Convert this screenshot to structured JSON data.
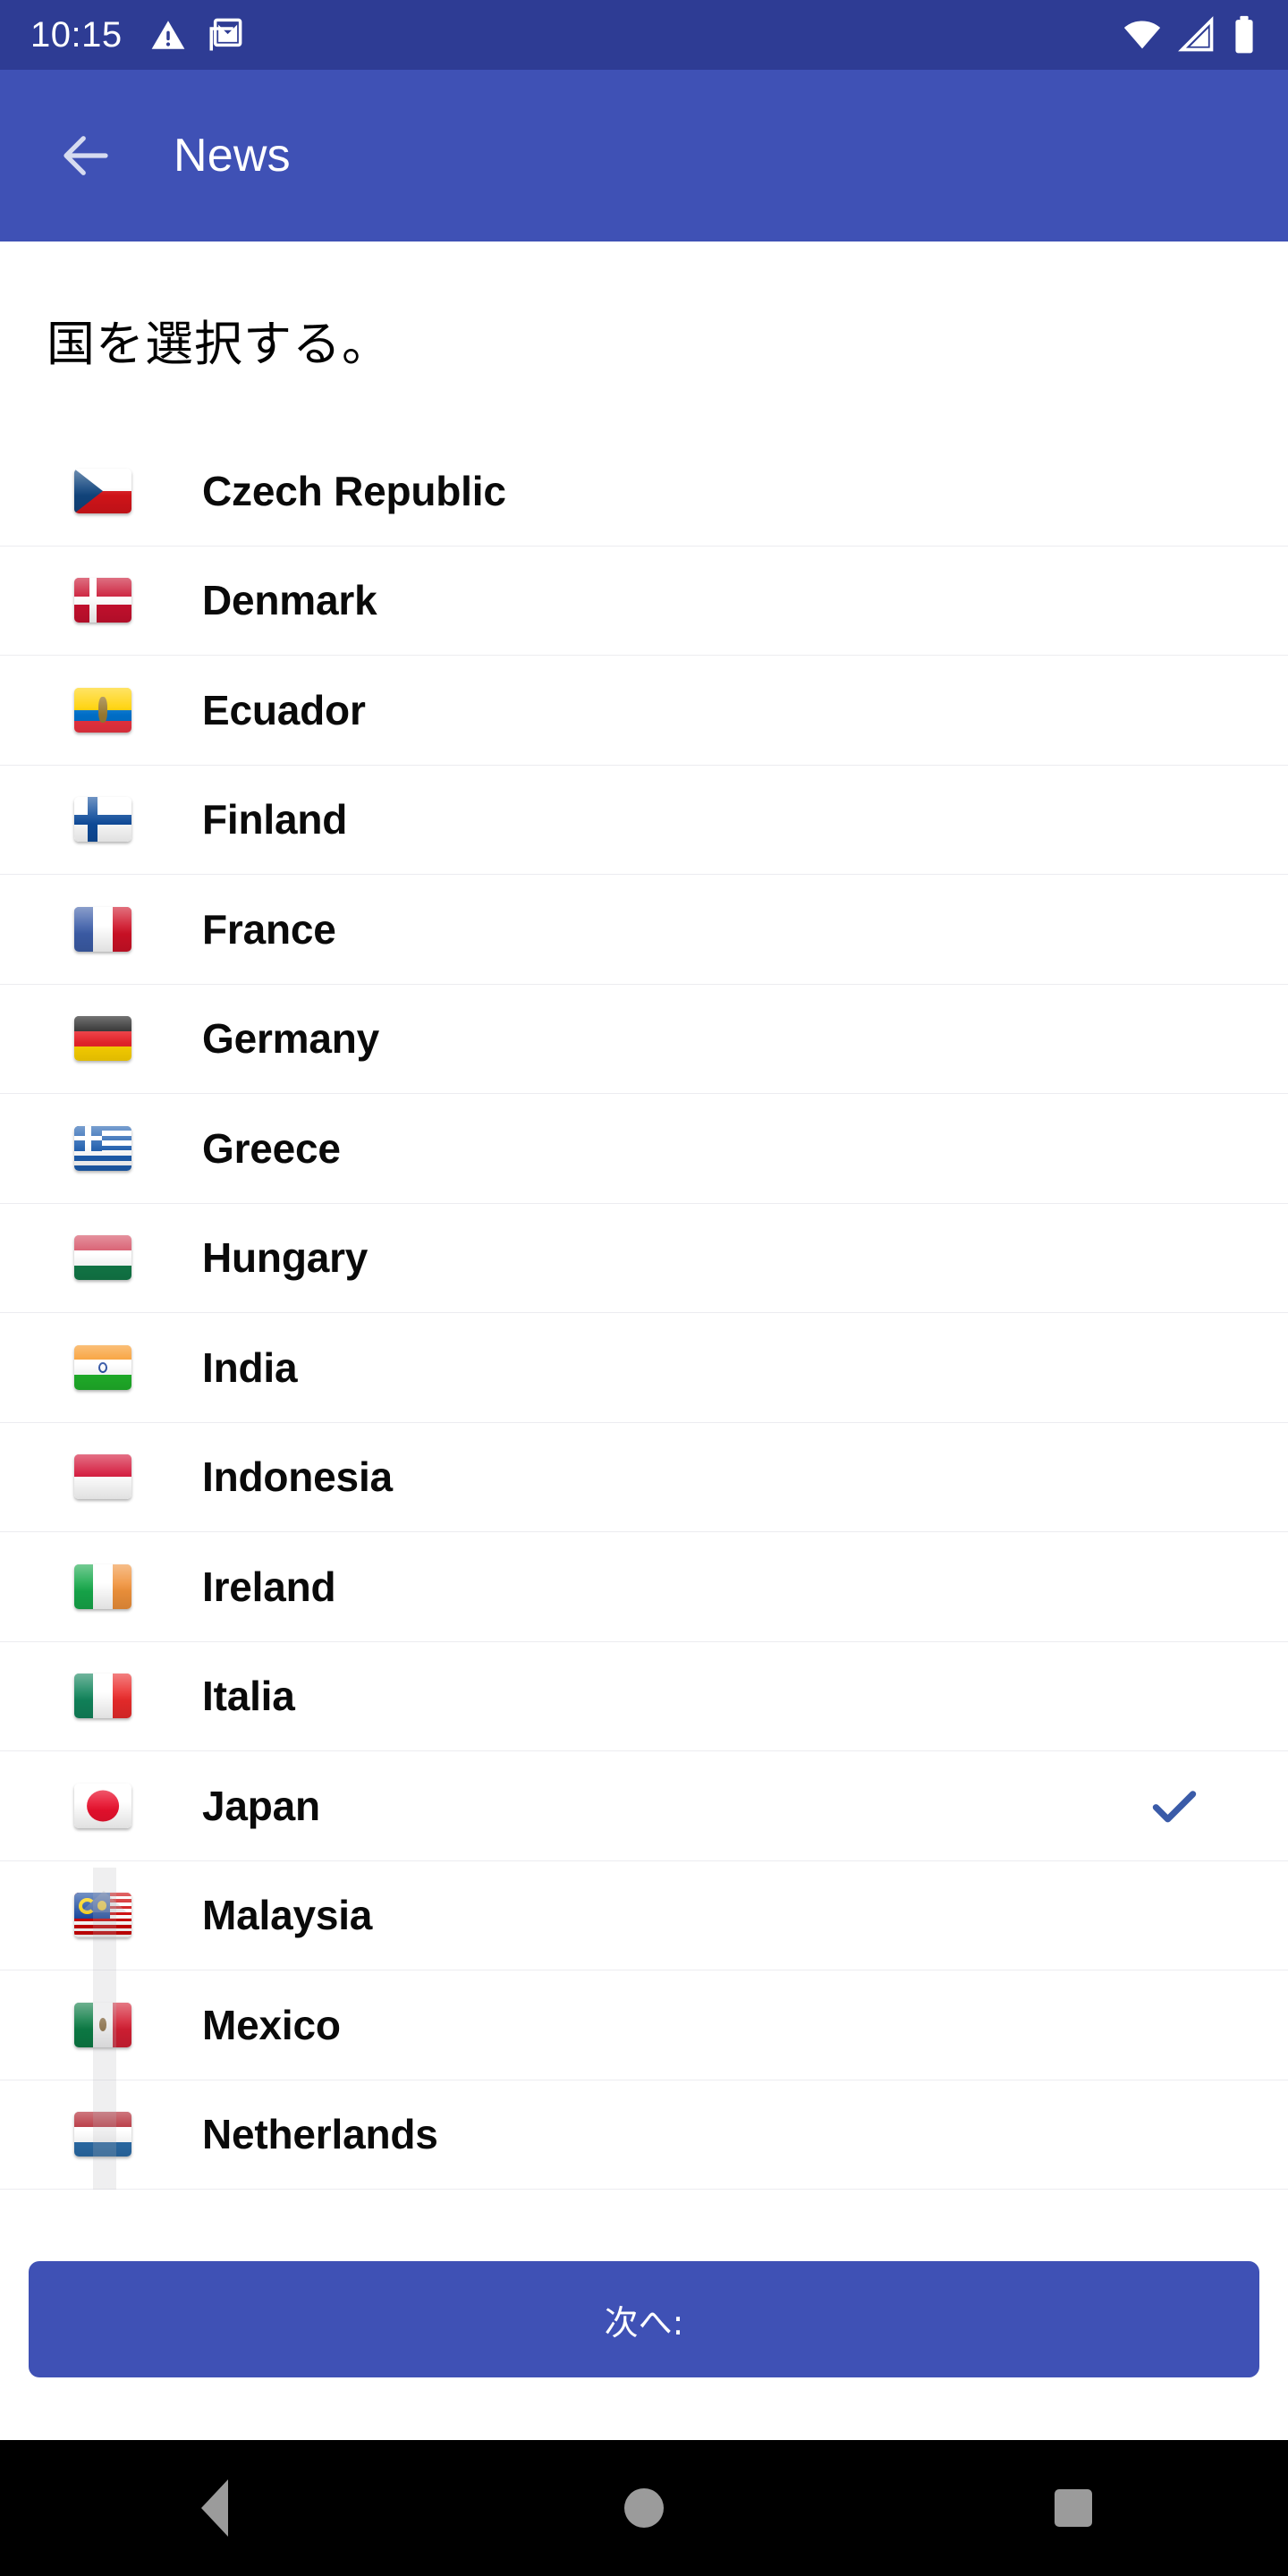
{
  "status_bar": {
    "time": "10:15",
    "left_icons": [
      "warning-triangle-icon",
      "gmail-icon"
    ],
    "right_icons": [
      "wifi-icon",
      "cell-signal-icon",
      "battery-icon"
    ],
    "background_color": "#2E3C94",
    "foreground_color": "#FFFFFF"
  },
  "app_bar": {
    "back_icon": "arrow-left-icon",
    "title": "News",
    "background_color": "#3F51B5",
    "text_color": "#FFFFFF"
  },
  "heading": {
    "text": "国を選択する。"
  },
  "list": {
    "selected_country": "Japan",
    "check_icon": "check-icon",
    "check_color": "#3A5BA8",
    "items": [
      {
        "name": "Czech Republic",
        "flag": "flag-cz",
        "selected": false
      },
      {
        "name": "Denmark",
        "flag": "flag-dk",
        "selected": false
      },
      {
        "name": "Ecuador",
        "flag": "flag-ec",
        "selected": false
      },
      {
        "name": "Finland",
        "flag": "flag-fi",
        "selected": false
      },
      {
        "name": "France",
        "flag": "flag-fr",
        "selected": false
      },
      {
        "name": "Germany",
        "flag": "flag-de",
        "selected": false
      },
      {
        "name": "Greece",
        "flag": "flag-gr",
        "selected": false
      },
      {
        "name": "Hungary",
        "flag": "flag-hu",
        "selected": false
      },
      {
        "name": "India",
        "flag": "flag-in",
        "selected": false
      },
      {
        "name": "Indonesia",
        "flag": "flag-id",
        "selected": false
      },
      {
        "name": "Ireland",
        "flag": "flag-ie",
        "selected": false
      },
      {
        "name": "Italia",
        "flag": "flag-it",
        "selected": false
      },
      {
        "name": "Japan",
        "flag": "flag-jp",
        "selected": true
      },
      {
        "name": "Malaysia",
        "flag": "flag-my",
        "selected": false
      },
      {
        "name": "Mexico",
        "flag": "flag-mx",
        "selected": false
      },
      {
        "name": "Netherlands",
        "flag": "flag-nl",
        "selected": false
      }
    ]
  },
  "primary_button": {
    "label": "次へ:",
    "background_color": "#3F51B5",
    "text_color": "#FFFFFF"
  },
  "nav_bar": {
    "background_color": "#000000",
    "icon_color": "#9B9B9B",
    "buttons": [
      {
        "name": "nav-back-icon"
      },
      {
        "name": "nav-home-icon"
      },
      {
        "name": "nav-recents-icon"
      }
    ]
  }
}
